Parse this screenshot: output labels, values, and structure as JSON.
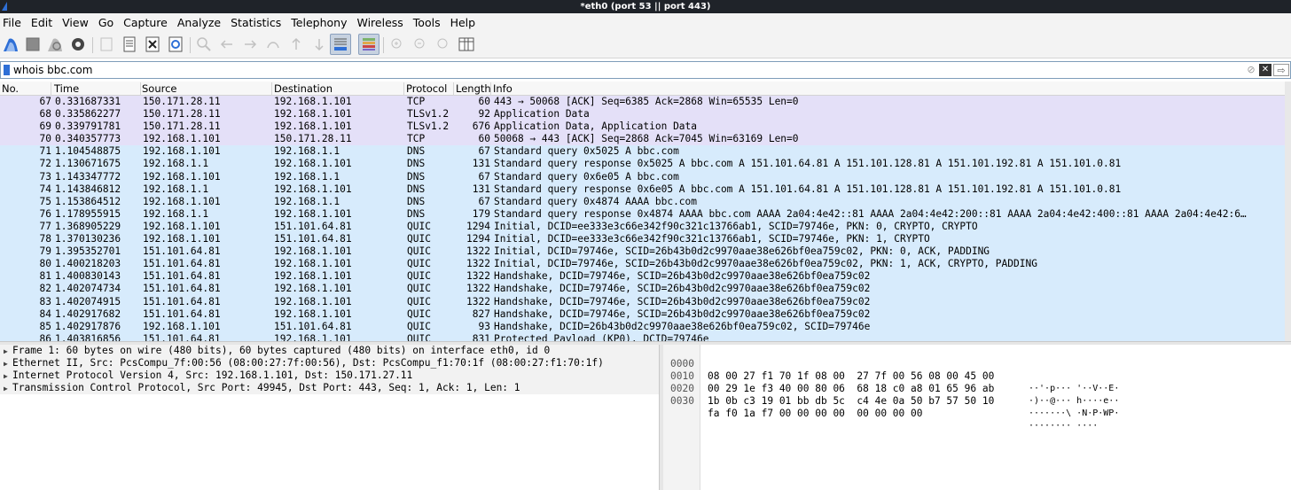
{
  "window": {
    "title": "*eth0 (port 53 || port 443)"
  },
  "menu": [
    "File",
    "Edit",
    "View",
    "Go",
    "Capture",
    "Analyze",
    "Statistics",
    "Telephony",
    "Wireless",
    "Tools",
    "Help"
  ],
  "toolbar": {
    "icons": [
      "start-capture-icon",
      "stop-capture-icon",
      "restart-capture-icon",
      "capture-options-icon",
      "open-file-icon",
      "save-file-icon",
      "close-file-icon",
      "reload-file-icon",
      "find-packet-icon",
      "go-back-icon",
      "go-forward-icon",
      "go-to-packet-icon",
      "first-packet-icon",
      "last-packet-icon",
      "autoscroll-icon",
      "colorize-icon",
      "zoom-in-icon",
      "zoom-out-icon",
      "normal-size-icon",
      "resize-columns-icon"
    ]
  },
  "filter": {
    "value": "whois bbc.com"
  },
  "columns": {
    "no": "No.",
    "time": "Time",
    "source": "Source",
    "destination": "Destination",
    "protocol": "Protocol",
    "length": "Length",
    "info": "Info"
  },
  "colors": {
    "tcp_row": "#e4e0f8",
    "udp_row": "#d7ebfc",
    "title_bg": "#1f2329",
    "accent": "#2e6fd6"
  },
  "packets": [
    {
      "no": "67",
      "time": "0.331687331",
      "src": "150.171.28.11",
      "dst": "192.168.1.101",
      "proto": "TCP",
      "len": "60",
      "info": "443 → 50068 [ACK] Seq=6385 Ack=2868 Win=65535 Len=0",
      "kind": "tcp"
    },
    {
      "no": "68",
      "time": "0.335862277",
      "src": "150.171.28.11",
      "dst": "192.168.1.101",
      "proto": "TLSv1.2",
      "len": "92",
      "info": "Application Data",
      "kind": "tcp"
    },
    {
      "no": "69",
      "time": "0.339791781",
      "src": "150.171.28.11",
      "dst": "192.168.1.101",
      "proto": "TLSv1.2",
      "len": "676",
      "info": "Application Data, Application Data",
      "kind": "tcp"
    },
    {
      "no": "70",
      "time": "0.340357773",
      "src": "192.168.1.101",
      "dst": "150.171.28.11",
      "proto": "TCP",
      "len": "60",
      "info": "50068 → 443 [ACK] Seq=2868 Ack=7045 Win=63169 Len=0",
      "kind": "tcp"
    },
    {
      "no": "71",
      "time": "1.104548875",
      "src": "192.168.1.101",
      "dst": "192.168.1.1",
      "proto": "DNS",
      "len": "67",
      "info": "Standard query 0x5025 A bbc.com",
      "kind": "udp"
    },
    {
      "no": "72",
      "time": "1.130671675",
      "src": "192.168.1.1",
      "dst": "192.168.1.101",
      "proto": "DNS",
      "len": "131",
      "info": "Standard query response 0x5025 A bbc.com A 151.101.64.81 A 151.101.128.81 A 151.101.192.81 A 151.101.0.81",
      "kind": "udp"
    },
    {
      "no": "73",
      "time": "1.143347772",
      "src": "192.168.1.101",
      "dst": "192.168.1.1",
      "proto": "DNS",
      "len": "67",
      "info": "Standard query 0x6e05 A bbc.com",
      "kind": "udp"
    },
    {
      "no": "74",
      "time": "1.143846812",
      "src": "192.168.1.1",
      "dst": "192.168.1.101",
      "proto": "DNS",
      "len": "131",
      "info": "Standard query response 0x6e05 A bbc.com A 151.101.64.81 A 151.101.128.81 A 151.101.192.81 A 151.101.0.81",
      "kind": "udp"
    },
    {
      "no": "75",
      "time": "1.153864512",
      "src": "192.168.1.101",
      "dst": "192.168.1.1",
      "proto": "DNS",
      "len": "67",
      "info": "Standard query 0x4874 AAAA bbc.com",
      "kind": "udp"
    },
    {
      "no": "76",
      "time": "1.178955915",
      "src": "192.168.1.1",
      "dst": "192.168.1.101",
      "proto": "DNS",
      "len": "179",
      "info": "Standard query response 0x4874 AAAA bbc.com AAAA 2a04:4e42::81 AAAA 2a04:4e42:200::81 AAAA 2a04:4e42:400::81 AAAA 2a04:4e42:6…",
      "kind": "udp"
    },
    {
      "no": "77",
      "time": "1.368905229",
      "src": "192.168.1.101",
      "dst": "151.101.64.81",
      "proto": "QUIC",
      "len": "1294",
      "info": "Initial, DCID=ee333e3c66e342f90c321c13766ab1, SCID=79746e, PKN: 0, CRYPTO, CRYPTO",
      "kind": "udp"
    },
    {
      "no": "78",
      "time": "1.370130236",
      "src": "192.168.1.101",
      "dst": "151.101.64.81",
      "proto": "QUIC",
      "len": "1294",
      "info": "Initial, DCID=ee333e3c66e342f90c321c13766ab1, SCID=79746e, PKN: 1, CRYPTO",
      "kind": "udp"
    },
    {
      "no": "79",
      "time": "1.395352701",
      "src": "151.101.64.81",
      "dst": "192.168.1.101",
      "proto": "QUIC",
      "len": "1322",
      "info": "Initial, DCID=79746e, SCID=26b43b0d2c9970aae38e626bf0ea759c02, PKN: 0, ACK, PADDING",
      "kind": "udp"
    },
    {
      "no": "80",
      "time": "1.400218203",
      "src": "151.101.64.81",
      "dst": "192.168.1.101",
      "proto": "QUIC",
      "len": "1322",
      "info": "Initial, DCID=79746e, SCID=26b43b0d2c9970aae38e626bf0ea759c02, PKN: 1, ACK, CRYPTO, PADDING",
      "kind": "udp"
    },
    {
      "no": "81",
      "time": "1.400830143",
      "src": "151.101.64.81",
      "dst": "192.168.1.101",
      "proto": "QUIC",
      "len": "1322",
      "info": "Handshake, DCID=79746e, SCID=26b43b0d2c9970aae38e626bf0ea759c02",
      "kind": "udp"
    },
    {
      "no": "82",
      "time": "1.402074734",
      "src": "151.101.64.81",
      "dst": "192.168.1.101",
      "proto": "QUIC",
      "len": "1322",
      "info": "Handshake, DCID=79746e, SCID=26b43b0d2c9970aae38e626bf0ea759c02",
      "kind": "udp"
    },
    {
      "no": "83",
      "time": "1.402074915",
      "src": "151.101.64.81",
      "dst": "192.168.1.101",
      "proto": "QUIC",
      "len": "1322",
      "info": "Handshake, DCID=79746e, SCID=26b43b0d2c9970aae38e626bf0ea759c02",
      "kind": "udp"
    },
    {
      "no": "84",
      "time": "1.402917682",
      "src": "151.101.64.81",
      "dst": "192.168.1.101",
      "proto": "QUIC",
      "len": "827",
      "info": "Handshake, DCID=79746e, SCID=26b43b0d2c9970aae38e626bf0ea759c02",
      "kind": "udp"
    },
    {
      "no": "85",
      "time": "1.402917876",
      "src": "192.168.1.101",
      "dst": "151.101.64.81",
      "proto": "QUIC",
      "len": "93",
      "info": "Handshake, DCID=26b43b0d2c9970aae38e626bf0ea759c02, SCID=79746e",
      "kind": "udp"
    },
    {
      "no": "86",
      "time": "1.403816856",
      "src": "151.101.64.81",
      "dst": "192.168.1.101",
      "proto": "QUIC",
      "len": "831",
      "info": "Protected Payload (KP0), DCID=79746e",
      "kind": "udp"
    }
  ],
  "details": [
    "Frame 1: 60 bytes on wire (480 bits), 60 bytes captured (480 bits) on interface eth0, id 0",
    "Ethernet II, Src: PcsCompu_7f:00:56 (08:00:27:7f:00:56), Dst: PcsCompu_f1:70:1f (08:00:27:f1:70:1f)",
    "Internet Protocol Version 4, Src: 192.168.1.101, Dst: 150.171.27.11",
    "Transmission Control Protocol, Src Port: 49945, Dst Port: 443, Seq: 1, Ack: 1, Len: 1"
  ],
  "bytes": [
    {
      "off": "0000",
      "hex": "08 00 27 f1 70 1f 08 00  27 7f 00 56 08 00 45 00",
      "ascii": "··'·p··· '··V··E·"
    },
    {
      "off": "0010",
      "hex": "00 29 1e f3 40 00 80 06  68 18 c0 a8 01 65 96 ab",
      "ascii": "·)··@··· h····e··"
    },
    {
      "off": "0020",
      "hex": "1b 0b c3 19 01 bb db 5c  c4 4e 0a 50 b7 57 50 10",
      "ascii": "·······\\ ·N·P·WP·"
    },
    {
      "off": "0030",
      "hex": "fa f0 1a f7 00 00 00 00  00 00 00 00",
      "ascii": "········ ····"
    }
  ]
}
